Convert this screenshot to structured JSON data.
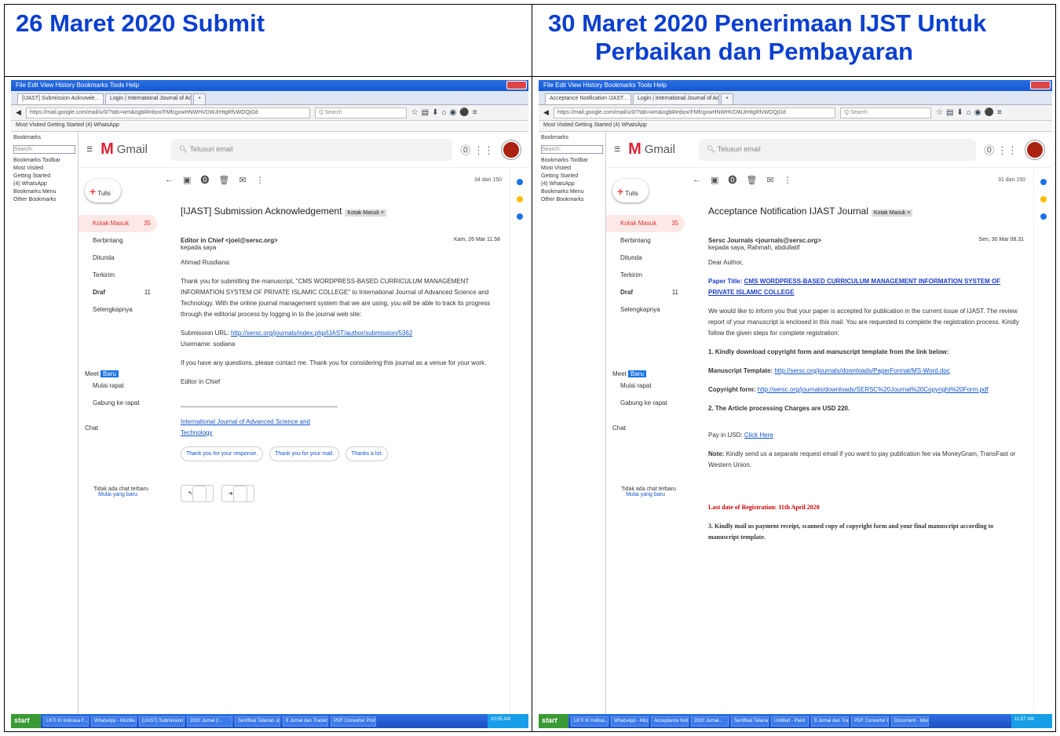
{
  "headers": {
    "left": "26 Maret 2020 Submit",
    "right_line1": "30 Maret 2020 Penerimaan IJST Untuk",
    "right_line2": "Perbaikan dan Pembayaran"
  },
  "common": {
    "gmail_label": "Gmail",
    "search_placeholder": "Telusuri email",
    "compose": "Tulis",
    "nav_inbox": "Kotak Masuk",
    "nav_starred": "Berbintang",
    "nav_snoozed": "Ditunda",
    "nav_sent": "Terkirim",
    "nav_draft": "Draf",
    "nav_draft_count": "11",
    "nav_more": "Selengkapnya",
    "meet": "Meet",
    "meet_new": "Baru",
    "meet_start": "Mulai rapat",
    "meet_join": "Gabung ke rapat",
    "chat": "Chat",
    "no_chat": "Tidak ada chat terbaru",
    "start_chat": "Mulai yang baru",
    "bookmarks_title": "Bookmarks",
    "search_label": "Search:",
    "bm_toolbar": "Bookmarks Toolbar",
    "bm_most_visited": "Most Visited",
    "bm_getting_started": "Getting Started",
    "bm_whatsapp": "(4) WhatsApp",
    "bm_menu": "Bookmarks Menu",
    "bm_other": "Other Bookmarks",
    "bmbar": "Most Visited   Getting Started   (4) WhatsApp",
    "menubar": "File  Edit  View  History  Bookmarks  Tools  Help",
    "start": "start"
  },
  "left_email": {
    "tab1": "[IJAST] Submission Acknowle...",
    "tab2": "Login | International Journal of Ad...",
    "url": "https://mail.google.com/mail/u/0/?tab=wm&ogbl#inbox/FMfcgxwHNWHVDWJrHtgRfvWDQjGd",
    "inbox_count": "35",
    "page": "34 dari 150",
    "subject": "[IJAST] Submission Acknowledgement",
    "label": "Kotak Masuk ×",
    "sender": "Editor in Chief <joel@sersc.org>",
    "to": "kepada saya",
    "date": "Kam, 26 Mar 11.58",
    "greeting": "Ahmad Rusdiana:",
    "para1": "Thank you for submitting the manuscript, \"CMS WORDPRESS-BASED CURRICULUM MANAGEMENT INFORMATION SYSTEM OF PRIVATE ISLAMIC COLLEGE\" to International Journal of Advanced Science and Technology. With the online journal management system that we are using, you will be able to track its progress through the editorial process by logging in to the journal web site:",
    "url_label": "Submission URL:",
    "submission_url": "http://sersc.org/journals/index.php/IJAST/author/submission/5362",
    "username": "Username: sodiana",
    "para2": "If you have any questions, please contact me. Thank you for considering this journal as a venue for your work.",
    "signoff": "Editor in Chief",
    "journal_link": "International Journal of Advanced Science and Technology",
    "smart1": "Thank you for your response.",
    "smart2": "Thank you for your mail.",
    "smart3": "Thanks a lot.",
    "reply": "Balas",
    "forward": "Teruskan",
    "taskbar1": "LKTI KI Indirasa F...",
    "taskbar2": "WhatsApp - Mozilla Fi...",
    "taskbar3": "[IJAST] Submission A...",
    "taskbar4": "2020 Jurnal (I...",
    "taskbar5": "Sertifikat Tatanan Jo...",
    "taskbar6": "9 Jurnal dan Tracking",
    "taskbar7": "PDF Converter Profe...",
    "clock": "10:55 AM"
  },
  "right_email": {
    "tab1": "Acceptance Notification IJAST...",
    "tab2": "Login | International Journal of Ad...",
    "url": "https://mail.google.com/mail/u/0/?tab=wm&ogbl#inbox/FMfcgxwHNWHVDWJrHtgRfvWDQjGd",
    "inbox_count": "35",
    "page": "31 dari 150",
    "subject": "Acceptance Notification IJAST Journal",
    "label": "Kotak Masuk ×",
    "sender": "Sersc Journals <journals@sersc.org>",
    "to": "kepada saya, Rahmah, abdullatif",
    "date": "Sen, 30 Mar 08.31",
    "greeting": "Dear Author,",
    "paper_title_label": "Paper Title:",
    "paper_title": "CMS WORDPRESS-BASED CURRICULUM MANAGEMENT INFORMATION SYSTEM OF PRIVATE ISLAMIC COLLEGE",
    "para1": "We would like to inform you that your paper is accepted for publication in the current issue of IJAST. The review report of your manuscript is enclosed in this mail. You are requested to complete the registration process. Kindly follow the given steps for complete registration:",
    "step1": "1. Kindly download copyright form and manuscript template from the link below:",
    "template_label": "Manuscript Template:",
    "template_url": "http://sersc.org/journals/downloads/PaperFormat/MS-Word.doc",
    "copyright_label": "Copyright form:",
    "copyright_url": "http://sersc.org/journals/downloads/SERSC%20Journal%20Copyright%20Form.pdf",
    "step2": "2. The Article processing Charges are USD 220.",
    "pay_label": "Pay in USD:",
    "pay_link": "Click Here",
    "note_label": "Note:",
    "note": "Kindly send us a separate request email if you want to pay publication fee via MoneyGram, TransFast or Western Union.",
    "deadline": "Last date of Registration: 11th April 2020",
    "step3": "3. Kindly mail us payment receipt, scanned copy of copyright form and your final manuscript according to manuscript template.",
    "taskbar1": "LKTI KI Indiras...",
    "taskbar2": "WhatsApp - Mozil...",
    "taskbar3": "Acceptance Notific...",
    "taskbar4": "2020 Jurnal...",
    "taskbar5": "Sertifikat Tatanan...",
    "taskbar6": "Untitled - Paint",
    "taskbar7": "9 Jurnal dan Trac...",
    "taskbar8": "PDF Converter Pro...",
    "taskbar9": "Document - Micro...",
    "clock": "11:57 AM"
  }
}
